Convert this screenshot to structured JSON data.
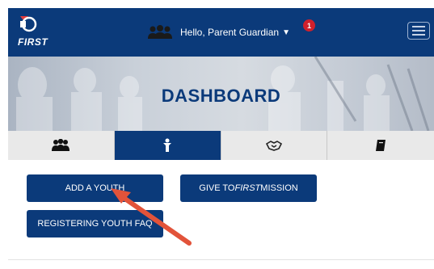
{
  "brand": {
    "logo_text": "FIRST"
  },
  "header": {
    "greeting": "Hello, Parent Guardian",
    "caret": "▼",
    "notification_count": "1"
  },
  "hero": {
    "title": "DASHBOARD"
  },
  "tabs": [
    {
      "icon": "people-group-icon",
      "active": false
    },
    {
      "icon": "person-icon",
      "active": true
    },
    {
      "icon": "handshake-icon",
      "active": false
    },
    {
      "icon": "book-icon",
      "active": false
    }
  ],
  "actions": {
    "add_youth": "ADD A YOUTH",
    "give_prefix": "GIVE TO ",
    "give_emphasis": "FIRST",
    "give_suffix": " MISSION",
    "faq": "REGISTERING YOUTH FAQ"
  },
  "colors": {
    "primary": "#0b3a7a",
    "badge": "#d0202c",
    "annotation_arrow": "#e2533a"
  }
}
